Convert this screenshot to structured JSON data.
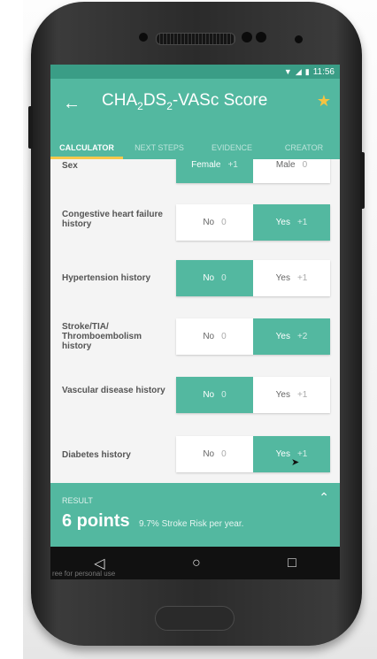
{
  "status": {
    "time": "11:56"
  },
  "app": {
    "title": "CHA",
    "title_sub1": "2",
    "title_mid": "DS",
    "title_sub2": "2",
    "title_end": "-VASc Score"
  },
  "tabs": [
    "CALCULATOR",
    "NEXT STEPS",
    "EVIDENCE",
    "CREATOR"
  ],
  "rows": [
    {
      "label": "Sex",
      "options": [
        {
          "label": "Female",
          "points": "+1",
          "selected": true
        },
        {
          "label": "Male",
          "points": "0",
          "selected": false
        }
      ]
    },
    {
      "label": "Congestive heart failure history",
      "options": [
        {
          "label": "No",
          "points": "0",
          "selected": false
        },
        {
          "label": "Yes",
          "points": "+1",
          "selected": true
        }
      ]
    },
    {
      "label": "Hypertension history",
      "options": [
        {
          "label": "No",
          "points": "0",
          "selected": true
        },
        {
          "label": "Yes",
          "points": "+1",
          "selected": false
        }
      ]
    },
    {
      "label": "Stroke/TIA/ Thromboembolism history",
      "options": [
        {
          "label": "No",
          "points": "0",
          "selected": false
        },
        {
          "label": "Yes",
          "points": "+2",
          "selected": true
        }
      ]
    },
    {
      "label": "Vascular disease history",
      "options": [
        {
          "label": "No",
          "points": "0",
          "selected": true
        },
        {
          "label": "Yes",
          "points": "+1",
          "selected": false
        }
      ]
    },
    {
      "label": "Diabetes history",
      "options": [
        {
          "label": "No",
          "points": "0",
          "selected": false
        },
        {
          "label": "Yes",
          "points": "+1",
          "selected": true
        }
      ]
    }
  ],
  "result": {
    "label": "RESULT",
    "score": "6 points",
    "risk": "9.7% Stroke Risk per year."
  },
  "watermark": "ree for personal use",
  "icons": {
    "back": "arrow-left",
    "favorite": "star",
    "expand": "chevron-up",
    "nav_back": "triangle-left",
    "nav_home": "circle",
    "nav_recents": "square"
  }
}
